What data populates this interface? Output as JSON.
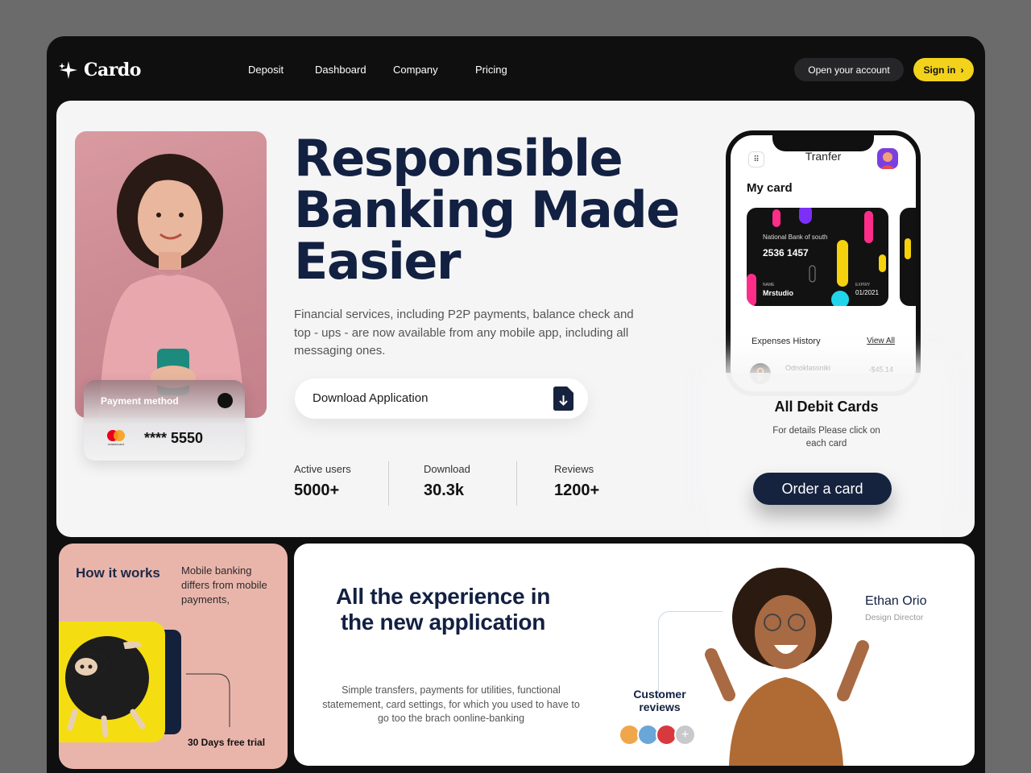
{
  "app": {
    "brand": "Cardo"
  },
  "nav": {
    "items": [
      "Deposit",
      "Dashboard",
      "Company",
      "Pricing"
    ]
  },
  "header": {
    "open_account": "Open your account",
    "sign_in": "Sign in"
  },
  "hero": {
    "headline": [
      "Responsible",
      "Banking Made",
      "Easier"
    ],
    "description": "Financial services, including P2P payments, balance check and top - ups - are now available from any mobile app, including all messaging ones.",
    "download_label": "Download Application",
    "payment_card": {
      "title": "Payment method",
      "number": "**** 5550",
      "brand_text": "mastercard"
    },
    "stats": [
      {
        "label": "Active users",
        "value": "5000+"
      },
      {
        "label": "Download",
        "value": "30.3k"
      },
      {
        "label": "Reviews",
        "value": "1200+"
      }
    ]
  },
  "phone": {
    "title": "Tranfer",
    "my_card": "My card",
    "card": {
      "bank": "National Bank of south",
      "number": "2536 1457",
      "name_label": "NAME",
      "name": "Mrstudio",
      "expiry_label": "EXPIRY",
      "expiry": "01/2021"
    },
    "expenses_title": "Expenses History",
    "view_all": "View All",
    "expense_row": {
      "name": "Odnoklassniki",
      "amount": "-$45.14"
    }
  },
  "debit": {
    "title": "All Debit Cards",
    "subtitle": "For details Please click on each card",
    "button": "Order a card"
  },
  "how": {
    "title": "How it works",
    "description": "Mobile banking differs from mobile payments,",
    "trial": "30 Days free trial"
  },
  "experience": {
    "title": "All the experience in the new application",
    "description": "Simple transfers, payments for utilities, functional statemement, card settings, for which you used to have to go too the brach oonline-banking",
    "reviews_label": "Customer reviews",
    "person": {
      "name": "Ethan Orio",
      "role": "Design Director"
    }
  },
  "colors": {
    "navy": "#122042",
    "yellow": "#f3d21b",
    "pink": "#e9b5ab",
    "dark": "#0f0f10"
  }
}
